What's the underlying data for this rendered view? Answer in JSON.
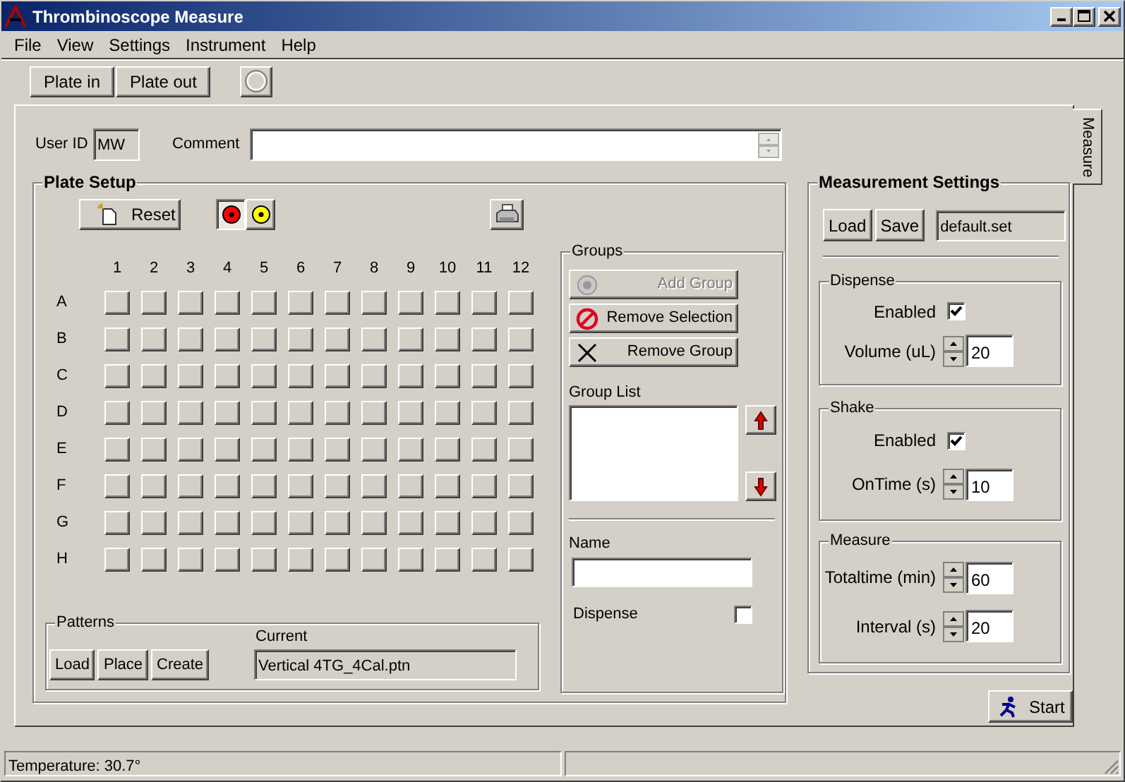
{
  "window": {
    "title": "Thrombinoscope Measure"
  },
  "menu": [
    "File",
    "View",
    "Settings",
    "Instrument",
    "Help"
  ],
  "toolbar": {
    "buttons": [
      "Plate in",
      "Plate out"
    ]
  },
  "user_id": {
    "label": "User ID",
    "value": "MW"
  },
  "comment": {
    "label": "Comment"
  },
  "plate_setup": {
    "title": "Plate Setup",
    "reset_label": "Reset",
    "marker_colors": [
      {
        "color": "#ff0000",
        "selected": true
      },
      {
        "color": "#ffff00",
        "selected": false
      }
    ],
    "columns": [
      "1",
      "2",
      "3",
      "4",
      "5",
      "6",
      "7",
      "8",
      "9",
      "10",
      "11",
      "12"
    ],
    "rows": [
      "A",
      "B",
      "C",
      "D",
      "E",
      "F",
      "G",
      "H"
    ],
    "patterns": {
      "title": "Patterns",
      "buttons": [
        "Load",
        "Place",
        "Create"
      ],
      "current_label": "Current",
      "current_value": "Vertical 4TG_4Cal.ptn"
    },
    "groups": {
      "title": "Groups",
      "buttons": [
        {
          "kind": "add",
          "label": "Add Group",
          "disabled": true
        },
        {
          "kind": "remove_selection",
          "label": "Remove Selection",
          "disabled": false
        },
        {
          "kind": "remove_group",
          "label": "Remove Group",
          "disabled": false
        }
      ],
      "list_label": "Group List",
      "name_label": "Name",
      "dispense_label": "Dispense",
      "dispense_checked": false
    }
  },
  "measurement_settings": {
    "title": "Measurement Settings",
    "buttons": [
      "Load",
      "Save"
    ],
    "file": "default.set",
    "sections": [
      {
        "title": "Dispense",
        "rows": [
          {
            "kind": "checkbox",
            "label": "Enabled",
            "checked": true
          },
          {
            "kind": "spinner",
            "label": "Volume (uL)",
            "value": "20"
          }
        ]
      },
      {
        "title": "Shake",
        "rows": [
          {
            "kind": "checkbox",
            "label": "Enabled",
            "checked": true
          },
          {
            "kind": "spinner",
            "label": "OnTime (s)",
            "value": "10"
          }
        ]
      },
      {
        "title": "Measure",
        "rows": [
          {
            "kind": "spinner",
            "label": "Totaltime (min)",
            "value": "60"
          },
          {
            "kind": "spinner",
            "label": "Interval (s)",
            "value": "20"
          }
        ]
      }
    ]
  },
  "start_button": {
    "label": "Start"
  },
  "side_tabs": [
    {
      "label": "Measure",
      "selected": true
    }
  ],
  "status_bar": {
    "panels": [
      "Temperature: 30.7°"
    ]
  }
}
